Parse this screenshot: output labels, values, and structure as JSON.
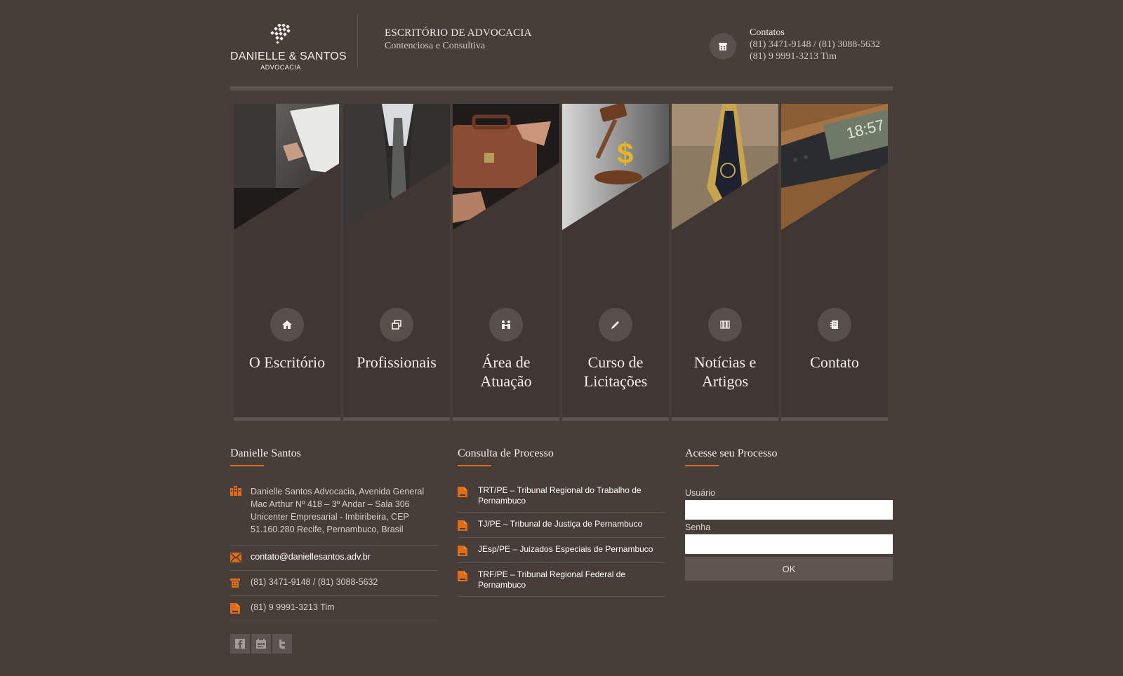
{
  "header": {
    "logo_name": "DANIELLE & SANTOS",
    "logo_sub": "ADVOCACIA",
    "tagline_title": "ESCRITÓRIO DE ADVOCACIA",
    "tagline_sub": "Contenciosa e Consultiva",
    "contact_title": "Contatos",
    "contact_phone1": "(81) 3471-9148 / (81) 3088-5632",
    "contact_phone2": "(81) 9 9991-3213 Tim",
    "contact_icon": "phone-icon"
  },
  "tiles": [
    {
      "label_line1": "O Escritório",
      "label_line2": "",
      "icon": "home-icon"
    },
    {
      "label_line1": "Profissionais",
      "label_line2": "",
      "icon": "windows-icon"
    },
    {
      "label_line1": "Área de",
      "label_line2": "Atuação",
      "icon": "people-icon"
    },
    {
      "label_line1": "Curso de",
      "label_line2": "Licitações",
      "icon": "edit-icon"
    },
    {
      "label_line1": "Notícias e",
      "label_line2": "Artigos",
      "icon": "books-icon"
    },
    {
      "label_line1": "Contato",
      "label_line2": "",
      "icon": "notebook-icon"
    }
  ],
  "about": {
    "title": "Danielle Santos",
    "address_line1": "Danielle Santos Advocacia, Avenida General",
    "address_line2": "Mac Arthur Nº 418 – 3º Andar – Sala 306",
    "address_line3": "Unicenter Empresarial - Imbiribeira, CEP",
    "address_line4": "51.160.280 Recife, Pernambuco, Brasil",
    "email": "contato@daniellesantos.adv.br",
    "phone": "(81) 3471-9148 / (81) 3088-5632",
    "mobile": "(81) 9 9991-3213 Tim",
    "social": [
      "facebook-icon",
      "calendar-icon",
      "twitter-icon"
    ]
  },
  "consulta": {
    "title": "Consulta de Processo",
    "links": [
      {
        "line1": "TRT/PE – Tribunal Regional do Trabalho de",
        "line2": "Pernambuco"
      },
      {
        "line1": "TJ/PE – Tribunal de Justiça de Pernambuco",
        "line2": ""
      },
      {
        "line1": "JEsp/PE – Juizados Especiais de Pernambuco",
        "line2": ""
      },
      {
        "line1": "TRF/PE – Tribunal Regional Federal de",
        "line2": "Pernambuco"
      }
    ]
  },
  "login": {
    "title": "Acesse seu Processo",
    "user_label": "Usuário",
    "user_value": "",
    "password_label": "Senha",
    "password_value": "",
    "submit_label": "OK"
  },
  "colors": {
    "background": "#473d39",
    "accent": "#e36c16",
    "tile": "#403734"
  }
}
